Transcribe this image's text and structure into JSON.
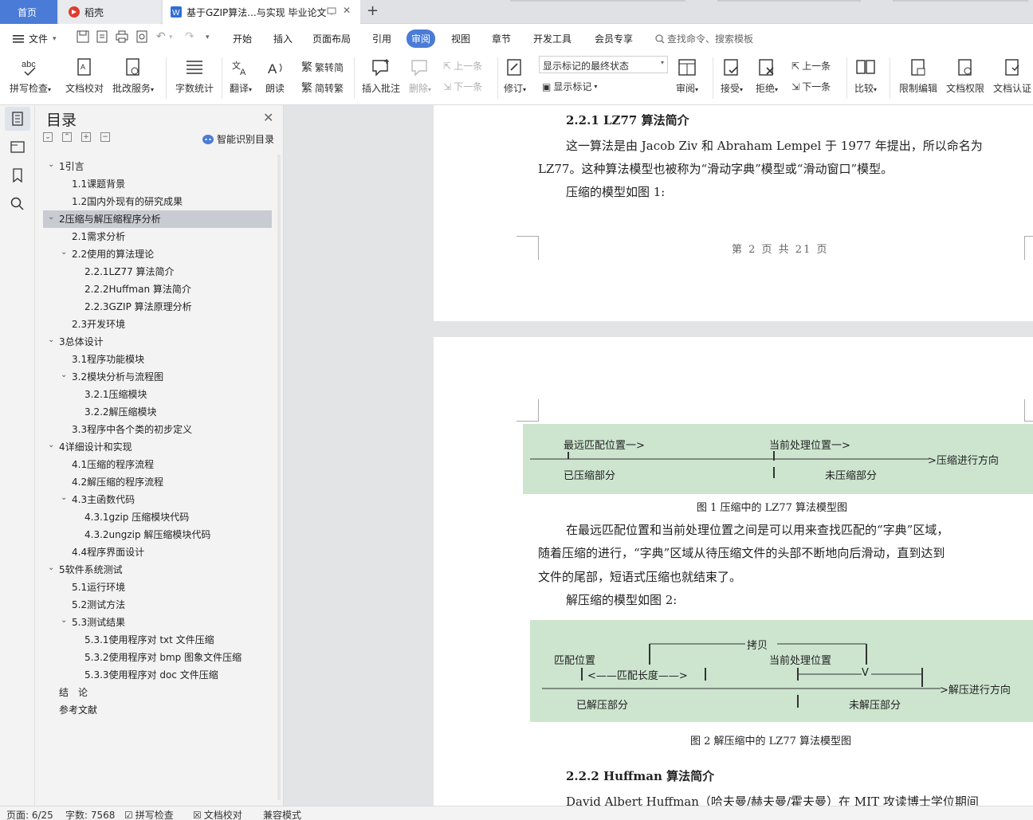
{
  "tabs": {
    "home": "首页",
    "daoke": "稻壳",
    "document": "基于GZIP算法...与实现 毕业论文"
  },
  "menu": {
    "file": "文件",
    "items": [
      "开始",
      "插入",
      "页面布局",
      "引用",
      "审阅",
      "视图",
      "章节",
      "开发工具",
      "会员专享"
    ],
    "search_placeholder": "查找命令、搜索模板"
  },
  "ribbon": {
    "spell_check": "拼写检查",
    "doc_proof": "文档校对",
    "batch_service": "批改服务",
    "word_count": "字数统计",
    "translate": "翻译",
    "read_aloud": "朗读",
    "to_traditional": "繁转简",
    "to_simplified": "简转繁",
    "insert_comment": "插入批注",
    "delete": "删除",
    "prev_comment": "上一条",
    "next_comment": "下一条",
    "revise": "修订",
    "markup_state": "显示标记的最终状态",
    "show_markup": "显示标记",
    "review": "审阅",
    "accept": "接受",
    "reject": "拒绝",
    "prev_change": "上一条",
    "next_change": "下一条",
    "compare": "比较",
    "restrict_edit": "限制编辑",
    "doc_permission": "文档权限",
    "doc_certify": "文档认证"
  },
  "toc": {
    "title": "目录",
    "smart": "智能识别目录",
    "items": [
      {
        "text": "1引言",
        "level": 1,
        "toggle": "open"
      },
      {
        "text": "1.1课题背景",
        "level": 2
      },
      {
        "text": "1.2国内外现有的研究成果",
        "level": 2
      },
      {
        "text": "2压缩与解压缩程序分析",
        "level": 1,
        "toggle": "open",
        "selected": true
      },
      {
        "text": "2.1需求分析",
        "level": 2
      },
      {
        "text": "2.2使用的算法理论",
        "level": 2,
        "toggle": "open"
      },
      {
        "text": "2.2.1LZ77 算法简介",
        "level": 3
      },
      {
        "text": "2.2.2Huffman 算法简介",
        "level": 3
      },
      {
        "text": "2.2.3GZIP 算法原理分析",
        "level": 3
      },
      {
        "text": "2.3开发环境",
        "level": 2
      },
      {
        "text": "3总体设计",
        "level": 1,
        "toggle": "open"
      },
      {
        "text": "3.1程序功能模块",
        "level": 2
      },
      {
        "text": "3.2模块分析与流程图",
        "level": 2,
        "toggle": "open"
      },
      {
        "text": "3.2.1压缩模块",
        "level": 3
      },
      {
        "text": "3.2.2解压缩模块",
        "level": 3
      },
      {
        "text": "3.3程序中各个类的初步定义",
        "level": 2
      },
      {
        "text": "4详细设计和实现",
        "level": 1,
        "toggle": "open"
      },
      {
        "text": "4.1压缩的程序流程",
        "level": 2
      },
      {
        "text": "4.2解压缩的程序流程",
        "level": 2
      },
      {
        "text": "4.3主函数代码",
        "level": 2,
        "toggle": "open"
      },
      {
        "text": "4.3.1gzip 压缩模块代码",
        "level": 3
      },
      {
        "text": "4.3.2ungzip 解压缩模块代码",
        "level": 3
      },
      {
        "text": "4.4程序界面设计",
        "level": 2
      },
      {
        "text": "5软件系统测试",
        "level": 1,
        "toggle": "open"
      },
      {
        "text": "5.1运行环境",
        "level": 2
      },
      {
        "text": "5.2测试方法",
        "level": 2
      },
      {
        "text": "5.3测试结果",
        "level": 2,
        "toggle": "open"
      },
      {
        "text": "5.3.1使用程序对 txt 文件压缩",
        "level": 3
      },
      {
        "text": "5.3.2使用程序对 bmp 图象文件压缩",
        "level": 3
      },
      {
        "text": "5.3.3使用程序对 doc 文件压缩",
        "level": 3
      },
      {
        "text": "结　论",
        "level": 1
      },
      {
        "text": "参考文献",
        "level": 1
      }
    ]
  },
  "document": {
    "heading_221": "2.2.1  LZ77 算法简介",
    "p1_line1": "这一算法是由 Jacob Ziv 和 Abraham Lempel 于 1977 年提出，所以命名为",
    "p1_line2": "LZ77。这种算法模型也被称为“滑动字典”模型或“滑动窗口”模型。",
    "p2": "压缩的模型如图 1:",
    "page_footer": "第 2 页 共 21 页",
    "fig1": {
      "label_far_match": "最远匹配位置一>",
      "label_current": "当前处理位置一>",
      "label_direction": ">压缩进行方向",
      "label_compressed": "已压缩部分",
      "label_uncompressed": "未压缩部分",
      "caption": "图 1  压缩中的 LZ77 算法模型图"
    },
    "p3_line1": "在最远匹配位置和当前处理位置之间是可以用来查找匹配的“字典”区域，",
    "p3_line2": "随着压缩的进行，“字典”区域从待压缩文件的头部不断地向后滑动，直到达到",
    "p3_line3": "文件的尾部，短语式压缩也就结束了。",
    "p4": "解压缩的模型如图 2:",
    "fig2": {
      "label_copy": "拷贝",
      "label_match_pos": "匹配位置",
      "label_current": "当前处理位置",
      "label_match_len": "<——匹配长度——>",
      "label_v": "V",
      "label_direction": ">解压进行方向",
      "label_decompressed": "已解压部分",
      "label_undecompressed": "未解压部分",
      "caption": "图 2  解压缩中的 LZ77 算法模型图"
    },
    "heading_222": "2.2.2  Huffman 算法简介",
    "p5": "David Albert Huffman（哈夫曼/赫夫曼/霍夫曼）在 MIT 攻读博士学位期间"
  },
  "status": {
    "page": "页面: 6/25",
    "words": "字数: 7568",
    "spell": "拼写检查",
    "proof": "文档校对",
    "compat": "兼容模式"
  },
  "colors": {
    "accent": "#4a7bd6",
    "figure_bg": "#cde5cf",
    "selected_toc": "#c8ccd2"
  }
}
